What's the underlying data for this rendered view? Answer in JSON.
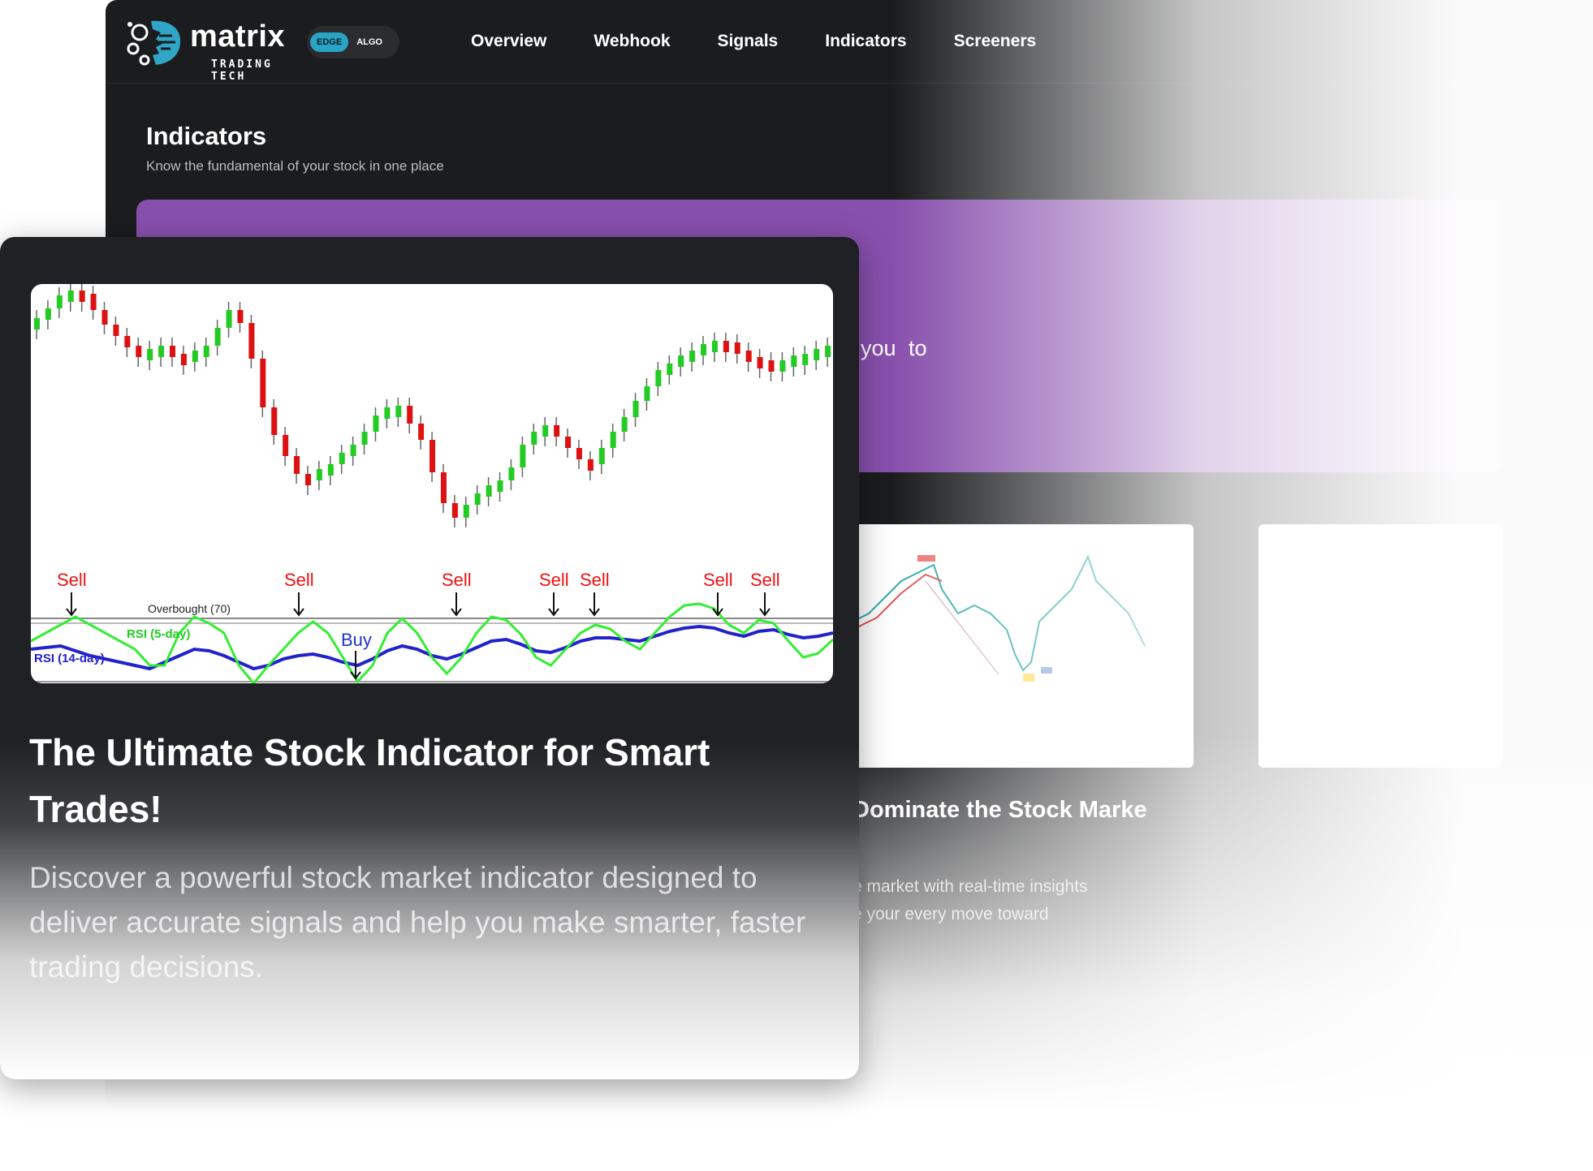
{
  "nav": {
    "logo_word": "matrix",
    "logo_sub": "TRADING TECH",
    "plan_edge": "EDGE",
    "plan_algo": "ALGO",
    "links": [
      "Overview",
      "Webhook",
      "Signals",
      "Indicators",
      "Screeners"
    ]
  },
  "page": {
    "title": "Indicators",
    "subtitle": "Know the fundamental of your stock in one place"
  },
  "banner": {
    "text_fragment": "you  to"
  },
  "card2": {
    "title": "Dominate the Stock Marke",
    "desc_lines": [
      "e market with real-time insights",
      "e your every move toward"
    ]
  },
  "front_card": {
    "title": "The Ultimate Stock Indicator for Smart Trades!",
    "description": "Discover a powerful stock market indicator designed to deliver accurate signals and help you make smarter, faster trading decisions.",
    "chart": {
      "overbought_label": "Overbought (70)",
      "rsi5_label": "RSI (5-day)",
      "rsi14_label": "RSI (14-day)",
      "signals": [
        "Sell",
        "Sell",
        "Sell",
        "Sell",
        "Sell",
        "Sell",
        "Sell",
        "Buy"
      ]
    }
  },
  "colors": {
    "bg_dark": "#1b1c1e",
    "banner_purple": "#8850ad",
    "accent_cyan": "#29a4c4",
    "candle_up": "#22cc22",
    "candle_down": "#dd1111",
    "rsi5": "#33ee33",
    "rsi14": "#2222cc",
    "sell": "#ee1111",
    "buy": "#2233cc"
  }
}
